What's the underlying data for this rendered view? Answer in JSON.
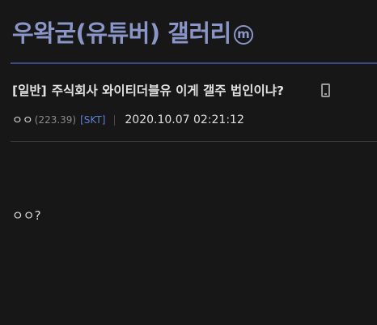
{
  "gallery": {
    "title": "우왁굳(유튜버) 갤러리",
    "badge": "m",
    "accent_color": "#8b96c8"
  },
  "post": {
    "head_tag": "[일반]",
    "title": "주식회사 와이티더블유 이게 갤주 법인이냐?",
    "device_icon": "mobile-phone-icon",
    "writer": {
      "nickname": "ㅇㅇ",
      "ip": "(223.39)",
      "carrier": "[SKT]"
    },
    "date": "2020.10.07 02:21:12",
    "body": "ㅇㅇ?"
  }
}
